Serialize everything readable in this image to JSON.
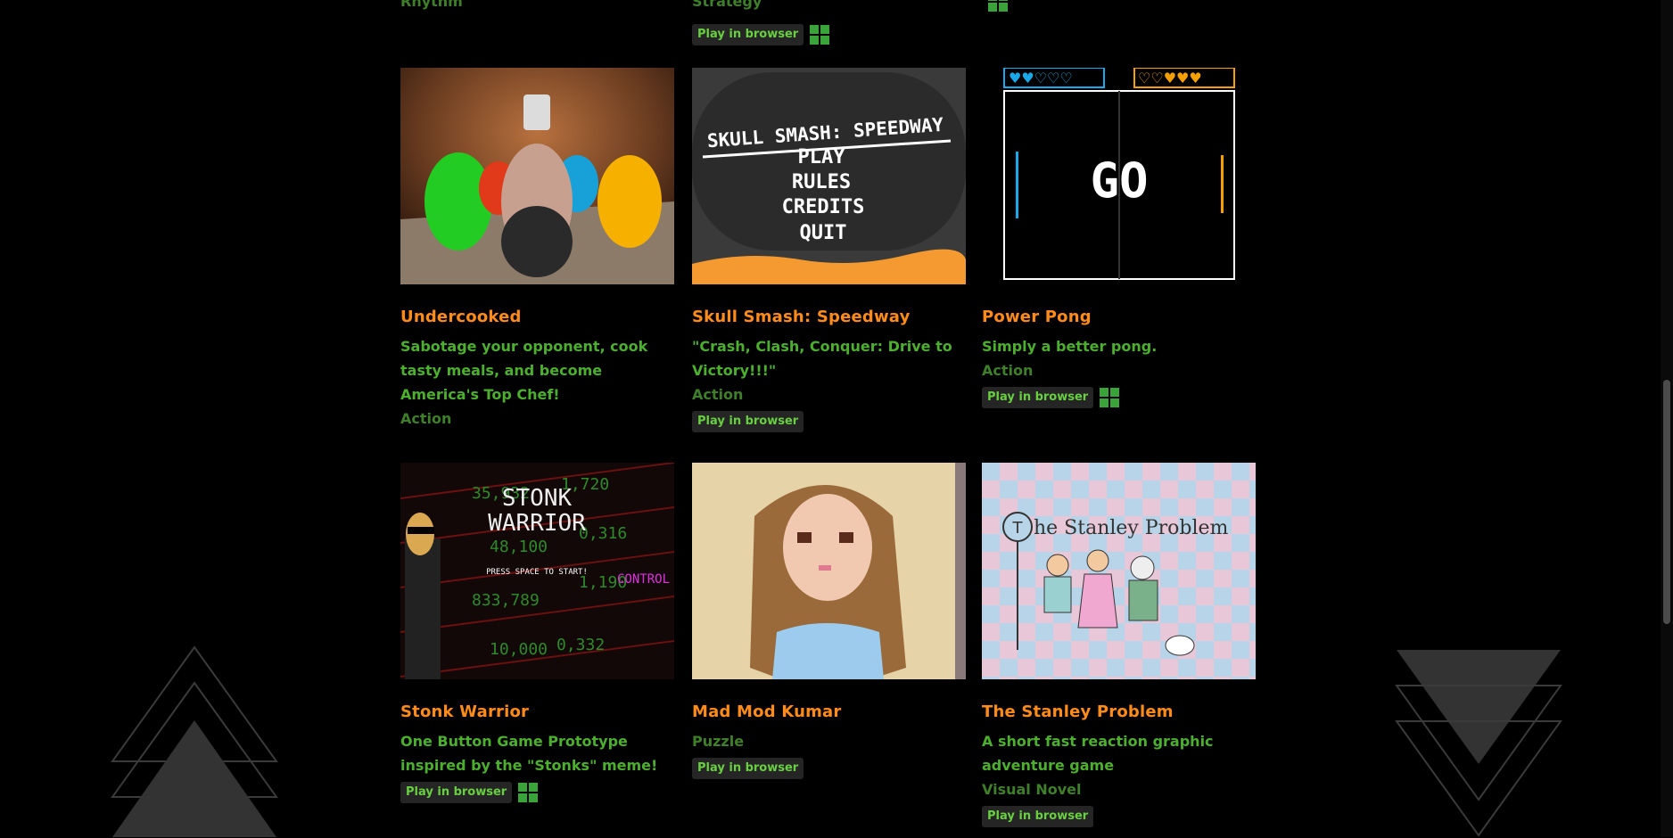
{
  "top_row": {
    "genre_1": "Rhythm",
    "genre_2": "Strategy",
    "play_label": "Play in browser"
  },
  "games": [
    {
      "title": "Undercooked",
      "desc": "Sabotage your opponent, cook tasty meals, and become America's Top Chef!",
      "genre": "Action",
      "browser": false,
      "windows": false
    },
    {
      "title": "Skull Smash: Speedway",
      "desc": "\"Crash, Clash, Conquer: Drive to Victory!!!\"",
      "genre": "Action",
      "browser": true,
      "windows": false
    },
    {
      "title": "Power Pong",
      "desc": "Simply a better pong.",
      "genre": "Action",
      "browser": true,
      "windows": true
    },
    {
      "title": "Stonk Warrior",
      "desc": "One Button Game Prototype inspired by the \"Stonks\" meme!",
      "genre": "",
      "browser": true,
      "windows": true
    },
    {
      "title": "Mad Mod Kumar",
      "desc": "",
      "genre": "Puzzle",
      "browser": true,
      "windows": false
    },
    {
      "title": "The Stanley Problem",
      "desc": "A short fast reaction graphic adventure game",
      "genre": "Visual Novel",
      "browser": true,
      "windows": false
    }
  ],
  "play_label": "Play in browser",
  "thumb_text": {
    "skull_title": "SKULL SMASH:  SPEEDWAY",
    "skull_menu": [
      "PLAY",
      "RULES",
      "CREDITS",
      "QUIT"
    ],
    "pong_go": "GO",
    "stonk_title_1": "STONK",
    "stonk_title_2": "WARRIOR",
    "stonk_press": "PRESS SPACE TO START!",
    "stonk_controls": "CONTROL",
    "stanley_title": "he Stanley Problem",
    "stanley_t": "T"
  },
  "colors": {
    "title": "#ff8c1a",
    "text": "#4caf2e",
    "windows": "#3aa33a"
  }
}
